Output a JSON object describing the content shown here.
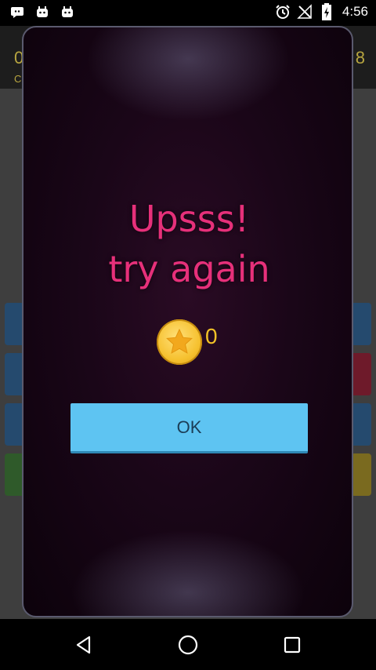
{
  "status_bar": {
    "time": "4:56",
    "left_icons": [
      "chat-bubble-icon",
      "robot-icon",
      "robot-icon"
    ],
    "right_icons": [
      "alarm-icon",
      "no-signal-icon",
      "battery-charging-icon"
    ]
  },
  "background_app": {
    "left_digit": "0",
    "left_small": "C",
    "right_digit": "8"
  },
  "dialog": {
    "title_line1": "Upsss!",
    "title_line2": "try again",
    "coins": "0",
    "ok_label": "OK"
  },
  "colors": {
    "title": "#e6307a",
    "coin": "#f6c12f",
    "button": "#5ec4f2"
  },
  "nav_bar": {
    "icons": [
      "back-icon",
      "home-icon",
      "recents-icon"
    ]
  }
}
